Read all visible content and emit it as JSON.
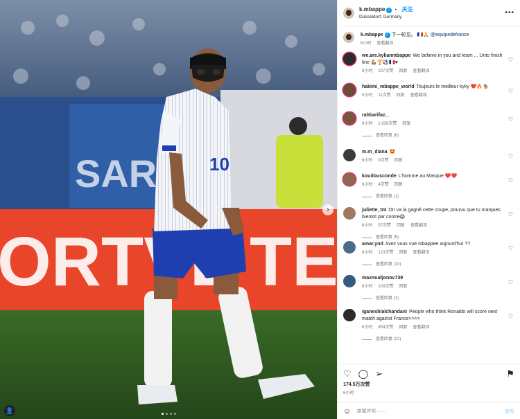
{
  "header": {
    "username": "k.mbappe",
    "verified": "✓",
    "separator": "•",
    "follow_label": "关注",
    "location": "Düsseldorf, Germany",
    "more": "•••"
  },
  "caption": {
    "username": "k.mbappe",
    "text": "下一轮见。",
    "extra": "🇫🇷🙏",
    "mention": "@equipedefrance",
    "time": "6小时",
    "translate": "查看翻译"
  },
  "comments": [
    {
      "user": "we.are.kylianmbappe",
      "text": "We believe in you and team ... Unto finish line 💪🏽🏆⚽🇫🇷♥",
      "time": "9小时",
      "likes": "207次赞",
      "reply": "回复",
      "translate": "查看翻译",
      "replies": "",
      "avatar_color": "#2b2b2b"
    },
    {
      "user": "hakimi_mbappe_world",
      "text": "Toujours le meilleur kyky ❤️🔥🐐",
      "time": "5小时",
      "likes": "11次赞",
      "reply": "回复",
      "translate": "查看翻译",
      "replies": "",
      "avatar_color": "#6b4c3b"
    },
    {
      "user": "rahbarifaz._",
      "text": "",
      "time": "6小时",
      "likes": "1,638次赞",
      "reply": "回复",
      "translate": "",
      "replies": "查看回复 (6)",
      "avatar_color": "#7a5540"
    },
    {
      "user": "m.m_diana",
      "text": "🤩",
      "time": "6小时",
      "likes": "9次赞",
      "reply": "回复",
      "translate": "",
      "replies": "",
      "avatar_color": "#3b3b3b"
    },
    {
      "user": "koudousconde",
      "text": "L'homme au Masque ❤️❤️",
      "time": "6小时",
      "likes": "4次赞",
      "reply": "回复",
      "translate": "",
      "replies": "查看回复 (1)",
      "avatar_color": "#8a6a50"
    },
    {
      "user": "juliette_tnt",
      "text": "On va la gagné cette coupe, pourvu que tu marques bientot par contre😱",
      "time": "6小时",
      "likes": "57次赞",
      "reply": "回复",
      "translate": "查看翻译",
      "replies": "查看回复 (5)",
      "avatar_color": "#a07a60"
    },
    {
      "user": "amar.ynd",
      "text": "Avez vous vue mbappee aujourd'hui ??",
      "time": "6小时",
      "likes": "123次赞",
      "reply": "回复",
      "translate": "查看翻译",
      "replies": "查看回复 (10)",
      "avatar_color": "#4a6a8a"
    },
    {
      "user": "maxmudjonov739",
      "text": "",
      "time": "6小时",
      "likes": "100次赞",
      "reply": "回复",
      "translate": "",
      "replies": "查看回复 (1)",
      "avatar_color": "#355a80"
    },
    {
      "user": "iganeshlalchandani",
      "text": "People who think Ronaldo will score next match against France>>>>",
      "time": "6小时",
      "likes": "859次赞",
      "reply": "回复",
      "translate": "查看翻译",
      "replies": "查看回复 (22)",
      "avatar_color": "#2a2a2a"
    }
  ],
  "actions": {
    "like_icon": "♡",
    "comment_icon": "◯",
    "share_icon": "➢",
    "save_icon": "⚑",
    "likes": "174.5万次赞",
    "time": "6小时"
  },
  "composer": {
    "emoji_icon": "☺",
    "placeholder": "添加评论……",
    "post_label": "发布"
  },
  "media": {
    "jersey_number": "10",
    "next_icon": "›",
    "user_tag_icon": "👤",
    "carousel_count": 4,
    "carousel_active": 1,
    "colors": {
      "shorts": "#1f3fb0",
      "board": "#e8452a",
      "pitch": "#2d5a1e"
    }
  }
}
